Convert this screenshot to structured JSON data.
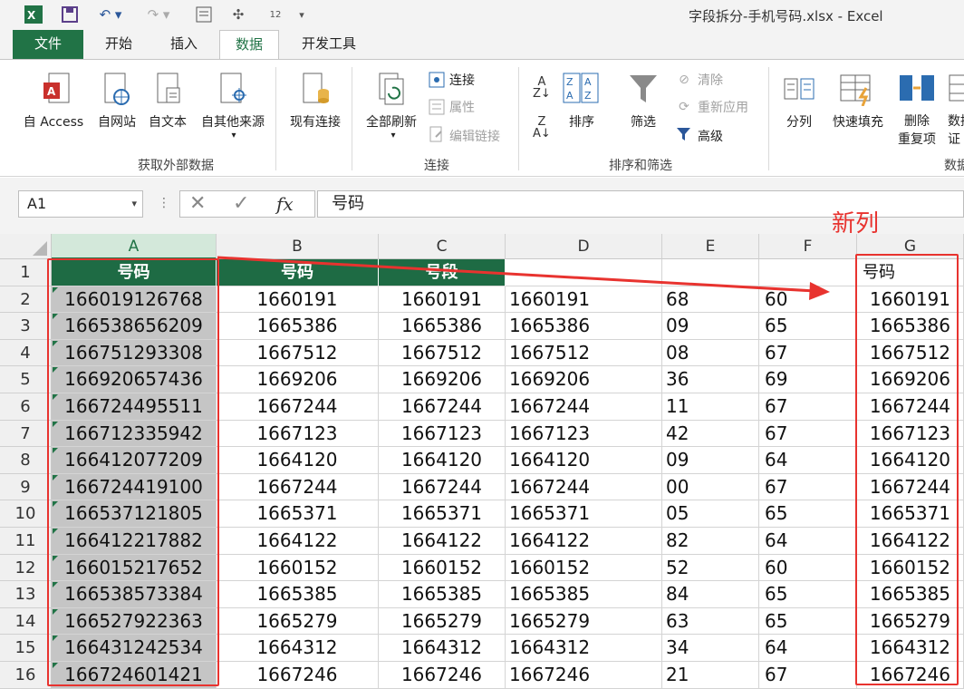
{
  "window": {
    "title": "字段拆分-手机号码.xlsx - Excel",
    "qat_redo": "12"
  },
  "tabs": [
    "文件",
    "开始",
    "插入",
    "数据",
    "开发工具"
  ],
  "ribbon": {
    "access": "自 Access",
    "web": "自网站",
    "text": "自文本",
    "other": "自其他来源",
    "existing": "现有连接",
    "refresh_all": "全部刷新",
    "connections": "连接",
    "properties": "属性",
    "edit_links": "编辑链接",
    "sort": "排序",
    "filter": "筛选",
    "clear": "清除",
    "reapply": "重新应用",
    "advanced": "高级",
    "split": "分列",
    "flash_fill": "快速填充",
    "remove_dup_1": "删除",
    "remove_dup_2": "重复项",
    "data_val_1": "数据",
    "data_val_2": "证",
    "sort_az": "A Z",
    "sort_za": "Z A",
    "group_external": "获取外部数据",
    "group_connections": "连接",
    "group_sort_filter": "排序和筛选",
    "group_data_tools": "数据"
  },
  "formula_bar": {
    "name_box": "A1",
    "fx": "fx",
    "formula": "号码"
  },
  "columns": [
    "A",
    "B",
    "C",
    "D",
    "E",
    "F",
    "G"
  ],
  "headers": {
    "A": "号码",
    "B": "号码",
    "C": "号段",
    "G": "号码"
  },
  "rows": [
    {
      "n": "1"
    },
    {
      "n": "2",
      "A": "166019126768",
      "B": "1660191",
      "C": "1660191",
      "D": "1660191",
      "E": "68",
      "F": "60",
      "G": "1660191"
    },
    {
      "n": "3",
      "A": "166538656209",
      "B": "1665386",
      "C": "1665386",
      "D": "1665386",
      "E": "09",
      "F": "65",
      "G": "1665386"
    },
    {
      "n": "4",
      "A": "166751293308",
      "B": "1667512",
      "C": "1667512",
      "D": "1667512",
      "E": "08",
      "F": "67",
      "G": "1667512"
    },
    {
      "n": "5",
      "A": "166920657436",
      "B": "1669206",
      "C": "1669206",
      "D": "1669206",
      "E": "36",
      "F": "69",
      "G": "1669206"
    },
    {
      "n": "6",
      "A": "166724495511",
      "B": "1667244",
      "C": "1667244",
      "D": "1667244",
      "E": "11",
      "F": "67",
      "G": "1667244"
    },
    {
      "n": "7",
      "A": "166712335942",
      "B": "1667123",
      "C": "1667123",
      "D": "1667123",
      "E": "42",
      "F": "67",
      "G": "1667123"
    },
    {
      "n": "8",
      "A": "166412077209",
      "B": "1664120",
      "C": "1664120",
      "D": "1664120",
      "E": "09",
      "F": "64",
      "G": "1664120"
    },
    {
      "n": "9",
      "A": "166724419100",
      "B": "1667244",
      "C": "1667244",
      "D": "1667244",
      "E": "00",
      "F": "67",
      "G": "1667244"
    },
    {
      "n": "10",
      "A": "166537121805",
      "B": "1665371",
      "C": "1665371",
      "D": "1665371",
      "E": "05",
      "F": "65",
      "G": "1665371"
    },
    {
      "n": "11",
      "A": "166412217882",
      "B": "1664122",
      "C": "1664122",
      "D": "1664122",
      "E": "82",
      "F": "64",
      "G": "1664122"
    },
    {
      "n": "12",
      "A": "166015217652",
      "B": "1660152",
      "C": "1660152",
      "D": "1660152",
      "E": "52",
      "F": "60",
      "G": "1660152"
    },
    {
      "n": "13",
      "A": "166538573384",
      "B": "1665385",
      "C": "1665385",
      "D": "1665385",
      "E": "84",
      "F": "65",
      "G": "1665385"
    },
    {
      "n": "14",
      "A": "166527922363",
      "B": "1665279",
      "C": "1665279",
      "D": "1665279",
      "E": "63",
      "F": "65",
      "G": "1665279"
    },
    {
      "n": "15",
      "A": "166431242534",
      "B": "1664312",
      "C": "1664312",
      "D": "1664312",
      "E": "34",
      "F": "64",
      "G": "1664312"
    },
    {
      "n": "16",
      "A": "166724601421",
      "B": "1667246",
      "C": "1667246",
      "D": "1667246",
      "E": "21",
      "F": "67",
      "G": "1667246"
    }
  ],
  "annotation": "新列",
  "colors": {
    "excel_green": "#217346",
    "header_fill": "#1e6b44",
    "annotation_red": "#e8332f",
    "selection_gray": "#c5c5c5"
  }
}
